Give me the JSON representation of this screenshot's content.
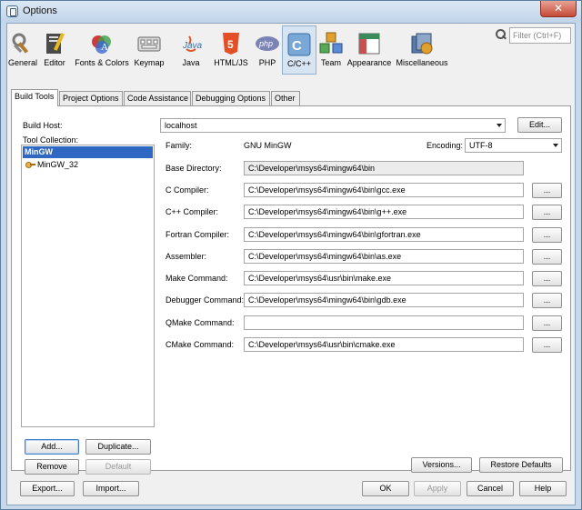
{
  "window": {
    "title": "Options",
    "close_symbol": "✕"
  },
  "search": {
    "placeholder": "Filter (Ctrl+F)",
    "icon": "search-icon"
  },
  "categories": [
    {
      "label": "General",
      "icon": "general-icon",
      "selected": false
    },
    {
      "label": "Editor",
      "icon": "editor-icon",
      "selected": false
    },
    {
      "label": "Fonts & Colors",
      "icon": "fonts-colors-icon",
      "selected": false
    },
    {
      "label": "Keymap",
      "icon": "keymap-icon",
      "selected": false
    },
    {
      "label": "Java",
      "icon": "java-icon",
      "selected": false
    },
    {
      "label": "HTML/JS",
      "icon": "html5-icon",
      "selected": false
    },
    {
      "label": "PHP",
      "icon": "php-icon",
      "selected": false
    },
    {
      "label": "C/C++",
      "icon": "cpp-icon",
      "selected": true
    },
    {
      "label": "Team",
      "icon": "team-icon",
      "selected": false
    },
    {
      "label": "Appearance",
      "icon": "appearance-icon",
      "selected": false
    },
    {
      "label": "Miscellaneous",
      "icon": "miscellaneous-icon",
      "selected": false
    }
  ],
  "tabs": [
    {
      "label": "Build Tools",
      "active": true
    },
    {
      "label": "Project Options",
      "active": false
    },
    {
      "label": "Code Assistance",
      "active": false
    },
    {
      "label": "Debugging Options",
      "active": false
    },
    {
      "label": "Other",
      "active": false
    }
  ],
  "build": {
    "build_host_label": "Build Host:",
    "build_host_value": "localhost",
    "edit_button": "Edit...",
    "tool_collection_label": "Tool Collection:",
    "collections": [
      {
        "name": "MinGW",
        "selected": true
      },
      {
        "name": "MinGW_32",
        "selected": false
      }
    ],
    "family_label": "Family:",
    "family_value": "GNU MinGW",
    "encoding_label": "Encoding:",
    "encoding_value": "UTF-8",
    "fields": [
      {
        "label": "Base Directory:",
        "value": "C:\\Developer\\msys64\\mingw64\\bin",
        "browse": null,
        "readonly": true
      },
      {
        "label": "C Compiler:",
        "value": "C:\\Developer\\msys64\\mingw64\\bin\\gcc.exe",
        "browse": "...",
        "readonly": false
      },
      {
        "label": "C++ Compiler:",
        "value": "C:\\Developer\\msys64\\mingw64\\bin\\g++.exe",
        "browse": "...",
        "readonly": false
      },
      {
        "label": "Fortran Compiler:",
        "value": "C:\\Developer\\msys64\\mingw64\\bin\\gfortran.exe",
        "browse": "...",
        "readonly": false
      },
      {
        "label": "Assembler:",
        "value": "C:\\Developer\\msys64\\mingw64\\bin\\as.exe",
        "browse": "...",
        "readonly": false
      },
      {
        "label": "Make Command:",
        "value": "C:\\Developer\\msys64\\usr\\bin\\make.exe",
        "browse": "...",
        "readonly": false
      },
      {
        "label": "Debugger Command:",
        "value": "C:\\Developer\\msys64\\mingw64\\bin\\gdb.exe",
        "browse": "...",
        "readonly": false
      },
      {
        "label": "QMake Command:",
        "value": "",
        "browse": "...",
        "readonly": false
      },
      {
        "label": "CMake Command:",
        "value": "C:\\Developer\\msys64\\usr\\bin\\cmake.exe",
        "browse": "...",
        "readonly": false
      }
    ],
    "add_button": "Add...",
    "duplicate_button": "Duplicate...",
    "remove_button": "Remove",
    "default_button": "Default",
    "versions_button": "Versions...",
    "restore_defaults_button": "Restore Defaults"
  },
  "footer": {
    "export_button": "Export...",
    "import_button": "Import...",
    "ok_button": "OK",
    "apply_button": "Apply",
    "cancel_button": "Cancel",
    "help_button": "Help"
  },
  "colors": {
    "selection_blue": "#2f68c2",
    "window_frame": "#c6d8ea",
    "close_red": "#c44a36"
  }
}
